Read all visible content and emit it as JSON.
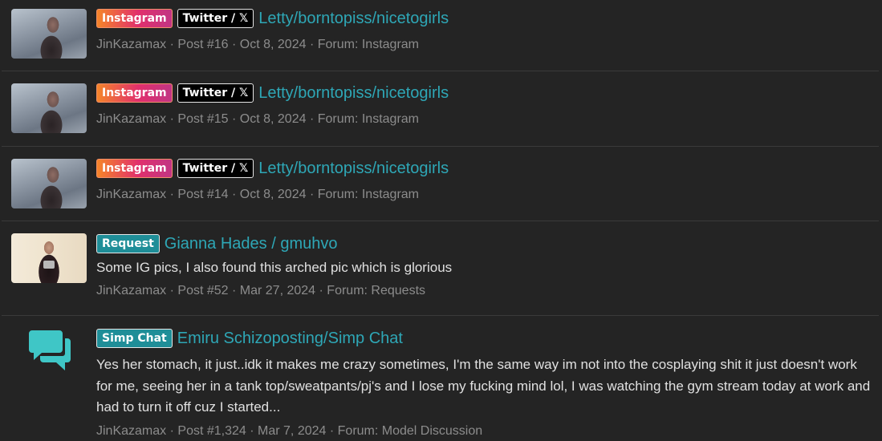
{
  "results": [
    {
      "badges": [
        {
          "label": "Instagram",
          "style": "instagram"
        },
        {
          "label": "Twitter / 𝕏",
          "style": "twitter"
        }
      ],
      "title": "Letty/borntopiss/nicetogirls",
      "author": "JinKazamax",
      "post": "Post #16",
      "date": "Oct 8, 2024",
      "forum": "Forum: Instagram"
    },
    {
      "badges": [
        {
          "label": "Instagram",
          "style": "instagram"
        },
        {
          "label": "Twitter / 𝕏",
          "style": "twitter"
        }
      ],
      "title": "Letty/borntopiss/nicetogirls",
      "author": "JinKazamax",
      "post": "Post #15",
      "date": "Oct 8, 2024",
      "forum": "Forum: Instagram"
    },
    {
      "badges": [
        {
          "label": "Instagram",
          "style": "instagram"
        },
        {
          "label": "Twitter / 𝕏",
          "style": "twitter"
        }
      ],
      "title": "Letty/borntopiss/nicetogirls",
      "author": "JinKazamax",
      "post": "Post #14",
      "date": "Oct 8, 2024",
      "forum": "Forum: Instagram"
    },
    {
      "badges": [
        {
          "label": "Request",
          "style": "teal"
        }
      ],
      "title": "Gianna Hades / gmuhvo",
      "snippet": "Some IG pics, I also found this arched pic which is glorious",
      "author": "JinKazamax",
      "post": "Post #52",
      "date": "Mar 27, 2024",
      "forum": "Forum: Requests"
    },
    {
      "badges": [
        {
          "label": "Simp Chat",
          "style": "teal"
        }
      ],
      "title": "Emiru Schizoposting/Simp Chat",
      "snippet": "Yes her stomach, it just..idk it makes me crazy sometimes, I'm the same way im not into the cosplaying shit it just doesn't work for me, seeing her in a tank top/sweatpants/pj's and I lose my fucking mind lol, I was watching the gym stream today at work and had to turn it off cuz I started...",
      "author": "JinKazamax",
      "post": "Post #1,324",
      "date": "Mar 7, 2024",
      "forum": "Forum: Model Discussion"
    }
  ],
  "separator": "·",
  "colors": {
    "background": "#242424",
    "link": "#2ea7b6",
    "meta": "#8c8c8c",
    "chat_icon": "#3fc6c6"
  }
}
